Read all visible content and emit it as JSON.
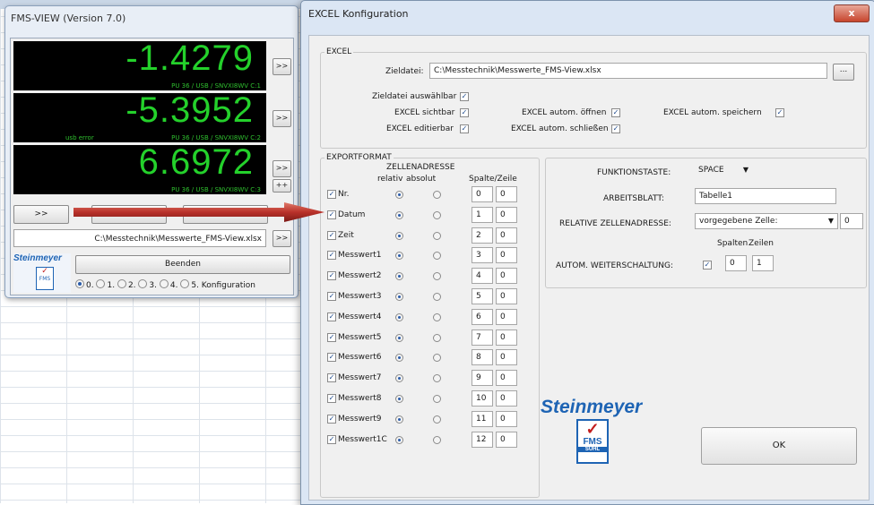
{
  "fms_window": {
    "title": "FMS-VIEW (Version 7.0)",
    "displays": [
      {
        "value": "-1.4279",
        "device": "PU 36 / USB / SNVXI8WV C:1",
        "error": ""
      },
      {
        "value": "-5.3952",
        "device": "PU 36 / USB / SNVXI8WV C:2",
        "error": "usb error"
      },
      {
        "value": "6.6972",
        "device": "PU 36 / USB / SNVXI8WV C:3",
        "error": ""
      }
    ],
    "side_button": ">>",
    "plus_button": "++",
    "left_button": ">>",
    "path": "C:\\Messtechnik\\Messwerte_FMS-View.xlsx",
    "path_button": ">>",
    "exit_button": "Beenden",
    "logo": {
      "brand": "Steinmeyer",
      "fms": "FMS"
    },
    "radios": [
      {
        "label": "0.",
        "selected": true
      },
      {
        "label": "1.",
        "selected": false
      },
      {
        "label": "2.",
        "selected": false
      },
      {
        "label": "3.",
        "selected": false
      },
      {
        "label": "4.",
        "selected": false
      },
      {
        "label": "5. Konfiguration",
        "selected": false
      }
    ]
  },
  "dialog": {
    "title": "EXCEL Konfiguration",
    "close": "x",
    "excel_group": {
      "title": "EXCEL",
      "file_label": "Zieldatei:",
      "file_value": "C:\\Messtechnik\\Messwerte_FMS-View.xlsx",
      "browse": "...",
      "checks": {
        "selectable": "Zieldatei auswählbar",
        "visible": "EXCEL sichtbar",
        "editable": "EXCEL editierbar",
        "auto_open": "EXCEL autom. öffnen",
        "auto_close": "EXCEL autom. schließen",
        "auto_save": "EXCEL autom. speichern"
      }
    },
    "export_group": {
      "title": "EXPORTFORMAT",
      "col_header": "ZELLENADRESSE",
      "col_relative": "relativ",
      "col_absolute": "absolut",
      "col_spalte": "Spalte/Zeile",
      "rows": [
        {
          "name": "Nr.",
          "spalte": "0",
          "zeile": "0"
        },
        {
          "name": "Datum",
          "spalte": "1",
          "zeile": "0"
        },
        {
          "name": "Zeit",
          "spalte": "2",
          "zeile": "0"
        },
        {
          "name": "Messwert1",
          "spalte": "3",
          "zeile": "0"
        },
        {
          "name": "Messwert2",
          "spalte": "4",
          "zeile": "0"
        },
        {
          "name": "Messwert3",
          "spalte": "5",
          "zeile": "0"
        },
        {
          "name": "Messwert4",
          "spalte": "6",
          "zeile": "0"
        },
        {
          "name": "Messwert5",
          "spalte": "7",
          "zeile": "0"
        },
        {
          "name": "Messwert6",
          "spalte": "8",
          "zeile": "0"
        },
        {
          "name": "Messwert7",
          "spalte": "9",
          "zeile": "0"
        },
        {
          "name": "Messwert8",
          "spalte": "10",
          "zeile": "0"
        },
        {
          "name": "Messwert9",
          "spalte": "11",
          "zeile": "0"
        },
        {
          "name": "Messwert1C",
          "spalte": "12",
          "zeile": "0"
        }
      ]
    },
    "right_group": {
      "function_key_label": "FUNKTIONSTASTE:",
      "function_key_value": "SPACE",
      "sheet_label": "ARBEITSBLATT:",
      "sheet_value": "Tabelle1",
      "rel_addr_label": "RELATIVE ZELLENADRESSE:",
      "rel_addr_value": "vorgegebene Zelle:",
      "rel_addr_num": "0",
      "spalten_label": "Spalten",
      "zeilen_label": "Zeilen",
      "auto_label": "AUTOM. WEITERSCHALTUNG:",
      "auto_spalten": "0",
      "auto_zeilen": "1"
    },
    "logo": {
      "brand": "Steinmeyer",
      "fms": "FMS",
      "suhl": "SUHL"
    },
    "ok": "OK"
  }
}
